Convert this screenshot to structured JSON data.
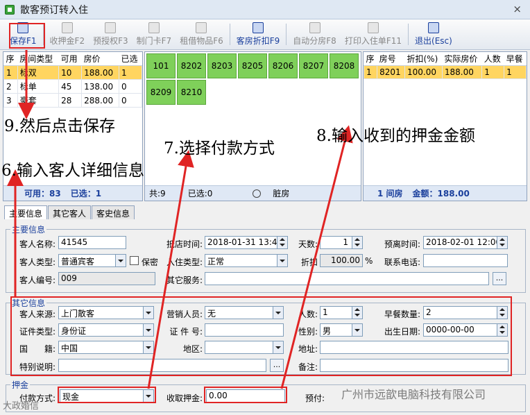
{
  "window": {
    "title": "散客预订转入住",
    "close": "×"
  },
  "toolbar": [
    {
      "label": "保存F1",
      "enabled": true
    },
    {
      "label": "收押金F2",
      "enabled": false
    },
    {
      "label": "预授权F3",
      "enabled": false
    },
    {
      "label": "制门卡F7",
      "enabled": false
    },
    {
      "label": "租借物品F6",
      "enabled": false
    },
    {
      "label": "客房折扣F9",
      "enabled": true
    },
    {
      "label": "自动分房F8",
      "enabled": false
    },
    {
      "label": "打印入住单F11",
      "enabled": false
    },
    {
      "label": "退出(Esc)",
      "enabled": true
    }
  ],
  "room_types": {
    "headers": [
      "序",
      "房间类型",
      "可用",
      "房价",
      "已选"
    ],
    "rows": [
      [
        "1",
        "标双",
        "10",
        "188.00",
        "1"
      ],
      [
        "2",
        "标单",
        "45",
        "138.00",
        "0"
      ],
      [
        "3",
        "豪套",
        "28",
        "288.00",
        "0"
      ]
    ],
    "footer_available_label": "可用：",
    "footer_available": "83",
    "footer_selected_label": "已选：",
    "footer_selected": "1"
  },
  "rooms": {
    "items": [
      "101",
      "8202",
      "8203",
      "8205",
      "8206",
      "8207",
      "8208",
      "8209",
      "8210"
    ],
    "footer_total": "共:9",
    "footer_selected": "已选:0",
    "footer_dirty": "脏房"
  },
  "selected_rooms": {
    "headers": [
      "序",
      "房号",
      "折扣(%)",
      "实际房价",
      "人数",
      "早餐"
    ],
    "rows": [
      [
        "1",
        "8201",
        "100.00",
        "188.00",
        "1",
        "1"
      ]
    ],
    "footer_count": "1 间房",
    "footer_amount_label": "金额：",
    "footer_amount": "188.00"
  },
  "annotations": {
    "a9": "9.然后点击保存",
    "a7": "7.选择付款方式",
    "a8": "8.输入收到的押金金额",
    "a6": "6.输入客人详细信息"
  },
  "tabs": [
    "主要信息",
    "其它客人",
    "客史信息"
  ],
  "main_info": {
    "legend": "主要信息",
    "guest_name_label": "客人名称:",
    "guest_name": "41545",
    "guest_type_label": "客人类型:",
    "guest_type": "普通宾客",
    "confidential_label": "保密",
    "guest_no_label": "客人编号:",
    "guest_no": "009",
    "arrival_label": "抵店时间:",
    "arrival": "2018-01-31 13:40",
    "stay_type_label": "入住类型:",
    "stay_type": "正常",
    "other_service_label": "其它服务:",
    "other_service": "",
    "days_label": "天数:",
    "days": "1",
    "discount_label": "折扣",
    "discount": "100.00",
    "discount_unit": "%",
    "departure_label": "预离时间:",
    "departure": "2018-02-01 12:00",
    "phone_label": "联系电话:",
    "phone": ""
  },
  "other_info": {
    "legend": "其它信息",
    "source_label": "客人来源:",
    "source": "上门散客",
    "id_type_label": "证件类型:",
    "id_type": "身份证",
    "nationality_label": "国　　籍:",
    "nationality": "中国",
    "remark_label": "特别说明:",
    "remark": "",
    "sales_label": "营销人员:",
    "sales": "无",
    "id_no_label": "证 件 号:",
    "id_no": "",
    "region_label": "地区:",
    "region": "",
    "persons_label": "人数:",
    "persons": "1",
    "gender_label": "性别:",
    "gender": "男",
    "address_label": "地址:",
    "address": "",
    "note_label": "备注:",
    "note": "",
    "breakfast_label": "早餐数量:",
    "breakfast": "2",
    "birth_label": "出生日期:",
    "birth": "0000-00-00"
  },
  "deposit": {
    "legend": "押金",
    "pay_method_label": "付款方式:",
    "pay_method": "现金",
    "deposit_label": "收取押金:",
    "deposit": "0.00",
    "prepay_label": "预付:"
  },
  "watermark": {
    "left": "大政婚信",
    "right": "广州市远歆电脑科技有限公司"
  }
}
